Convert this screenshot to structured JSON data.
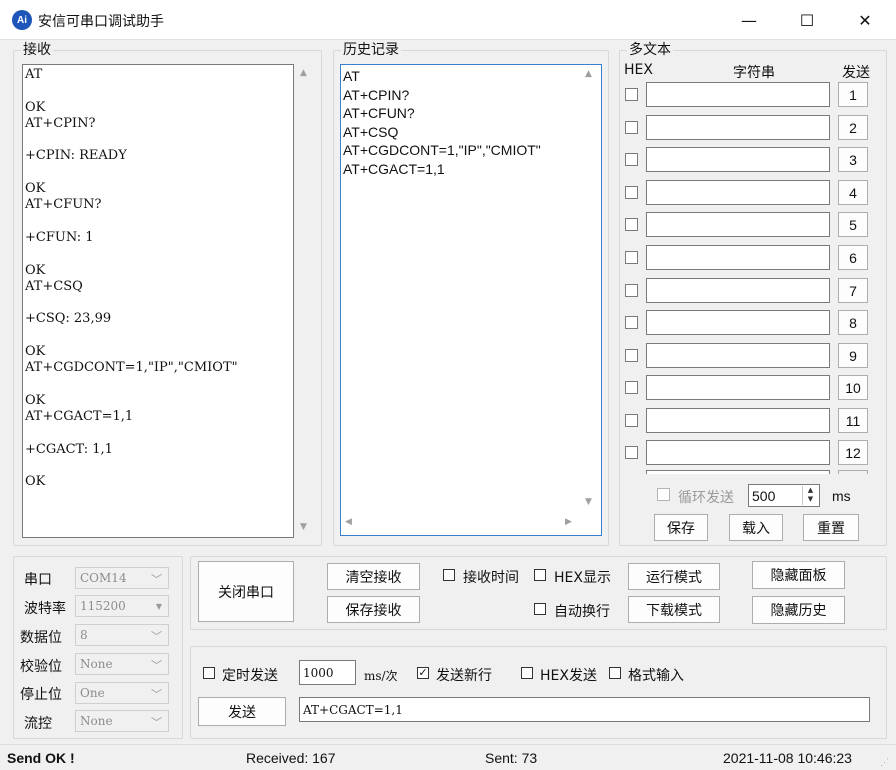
{
  "window": {
    "title": "安信可串口调试助手",
    "icon_text": "Ai",
    "minimize": "—",
    "maximize": "☐",
    "close": "✕"
  },
  "receive": {
    "label": "接收",
    "text": "AT\n\nOK\nAT+CPIN?\n\n+CPIN: READY\n\nOK\nAT+CFUN?\n\n+CFUN: 1\n\nOK\nAT+CSQ\n\n+CSQ: 23,99\n\nOK\nAT+CGDCONT=1,\"IP\",\"CMIOT\"\n\nOK\nAT+CGACT=1,1\n\n+CGACT: 1,1\n\nOK"
  },
  "history": {
    "label": "历史记录",
    "items": [
      "AT",
      "AT+CPIN?",
      "AT+CFUN?",
      "AT+CSQ",
      "AT+CGDCONT=1,\"IP\",\"CMIOT\"",
      "AT+CGACT=1,1"
    ]
  },
  "multitext": {
    "label": "多文本",
    "hex_header": "HEX",
    "string_header": "字符串",
    "send_header": "发送",
    "rows": [
      "1",
      "2",
      "3",
      "4",
      "5",
      "6",
      "7",
      "8",
      "9",
      "10",
      "11",
      "12"
    ],
    "loop_send_label": "循环发送",
    "interval_value": "500",
    "interval_unit": "ms",
    "save_label": "保存",
    "load_label": "载入",
    "reset_label": "重置"
  },
  "port": {
    "port_label": "串口",
    "port_value": "COM14",
    "baud_label": "波特率",
    "baud_value": "115200",
    "databits_label": "数据位",
    "databits_value": "8",
    "parity_label": "校验位",
    "parity_value": "None",
    "stopbits_label": "停止位",
    "stopbits_value": "One",
    "flow_label": "流控",
    "flow_value": "None"
  },
  "controls": {
    "close_port": "关闭串口",
    "clear_receive": "清空接收",
    "save_receive": "保存接收",
    "receive_time": "接收时间",
    "hex_display": "HEX显示",
    "auto_newline": "自动换行",
    "run_mode": "运行模式",
    "download_mode": "下载模式",
    "hide_panel": "隐藏面板",
    "hide_history": "隐藏历史"
  },
  "send": {
    "timed_send": "定时发送",
    "interval_value": "1000",
    "interval_unit": "ms/次",
    "send_newline": "发送新行",
    "check_mark": "✓",
    "hex_send": "HEX发送",
    "format_input": "格式输入",
    "send_button": "发送",
    "send_text": "AT+CGACT=1,1"
  },
  "status": {
    "message": "Send OK !",
    "received": "Received: 167",
    "sent": "Sent: 73",
    "datetime": "2021-11-08 10:46:23"
  }
}
